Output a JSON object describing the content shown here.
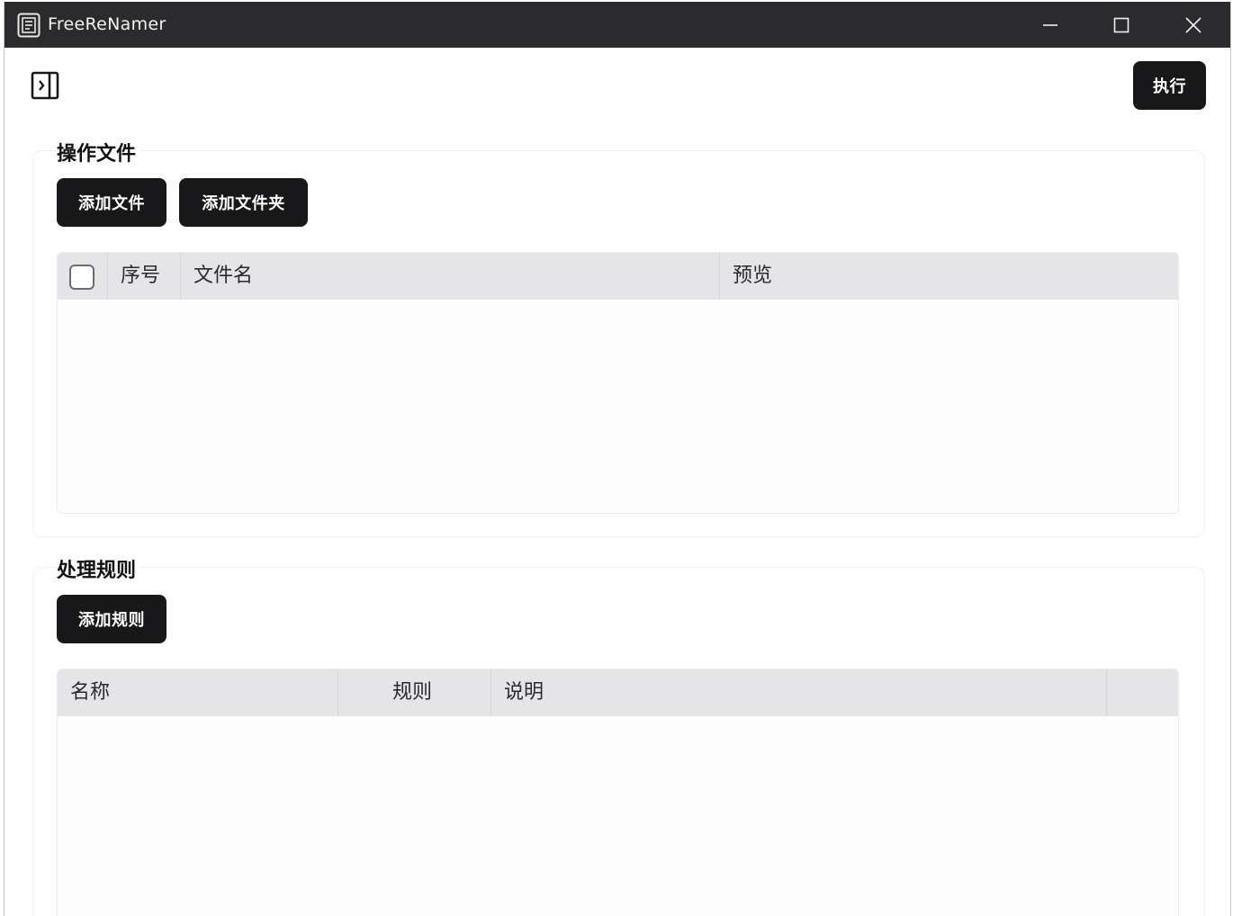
{
  "window": {
    "title": "FreeReNamer"
  },
  "toolbar": {
    "execute_label": "执行"
  },
  "files_section": {
    "title": "操作文件",
    "add_file_label": "添加文件",
    "add_folder_label": "添加文件夹",
    "table": {
      "columns": [
        "序号",
        "文件名",
        "预览"
      ],
      "rows": []
    }
  },
  "rules_section": {
    "title": "处理规则",
    "add_rule_label": "添加规则",
    "table": {
      "columns": [
        "名称",
        "规则",
        "说明",
        ""
      ],
      "rows": []
    }
  },
  "colors": {
    "titlebar": "#2b2b2d",
    "button": "#18181b",
    "table_header": "#e5e5e8"
  }
}
